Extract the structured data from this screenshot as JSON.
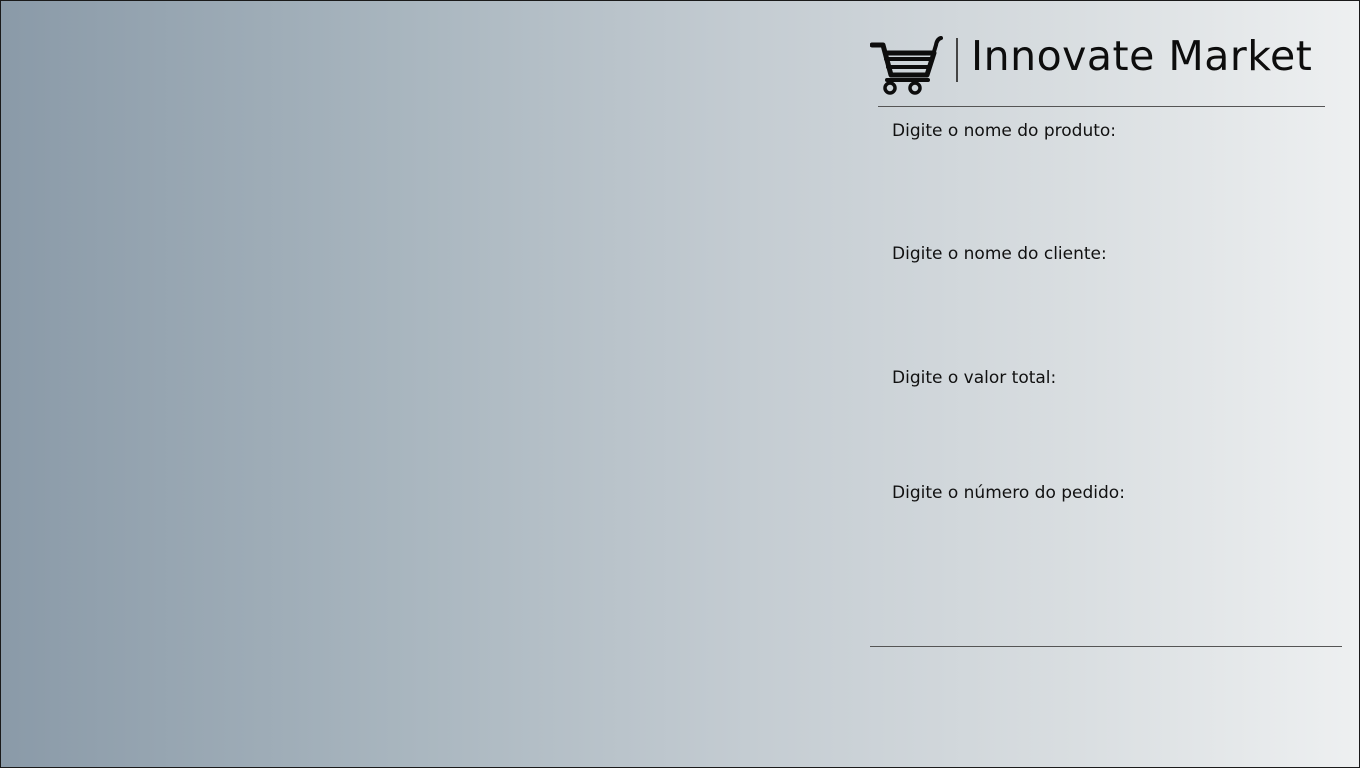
{
  "brand": {
    "name": "Innovate Market",
    "icon": "shopping-cart-icon"
  },
  "form": {
    "fields": [
      {
        "label": "Digite o nome do produto:",
        "value": "",
        "placeholder": ""
      },
      {
        "label": "Digite o nome do cliente:",
        "value": "",
        "placeholder": ""
      },
      {
        "label": "Digite o valor total:",
        "value": "",
        "placeholder": ""
      },
      {
        "label": "Digite o número do pedido:",
        "value": "",
        "placeholder": ""
      }
    ]
  },
  "colors": {
    "background_left": "#8a9aa8",
    "background_right": "#eef0f1",
    "text": "#111111",
    "rule": "#555555"
  }
}
